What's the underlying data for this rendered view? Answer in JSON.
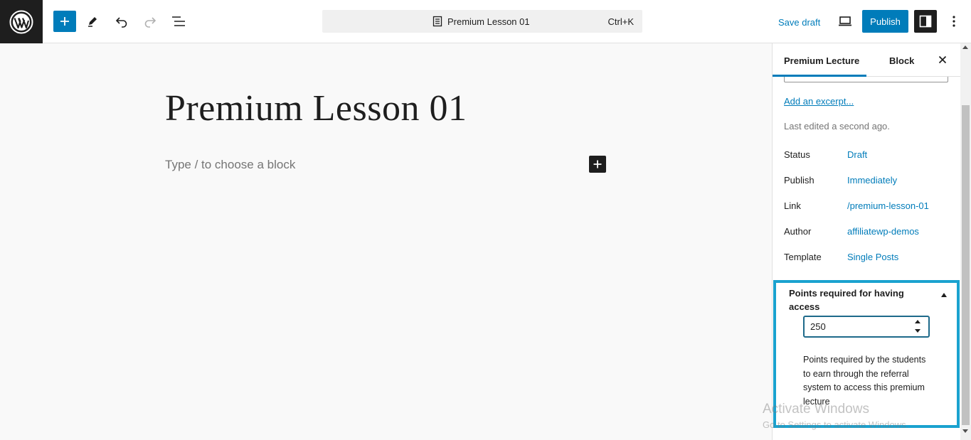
{
  "topbar": {
    "logo_icon": "wordpress-logo",
    "add_block_icon": "plus-icon",
    "tools_icon": "pencil-icon",
    "undo_icon": "undo-icon",
    "redo_icon": "redo-icon",
    "list_view_icon": "list-view-icon",
    "command_bar": {
      "title": "Premium Lesson 01",
      "shortcut": "Ctrl+K",
      "icon": "document-icon"
    },
    "save_draft_label": "Save draft",
    "preview_icon": "laptop-icon",
    "publish_label": "Publish",
    "settings_icon": "sidebar-toggle-icon",
    "more_icon": "vertical-ellipsis-icon"
  },
  "editor": {
    "post_title": "Premium Lesson 01",
    "block_placeholder": "Type / to choose a block"
  },
  "sidebar": {
    "tabs": [
      {
        "label": "Premium Lecture",
        "active": true
      },
      {
        "label": "Block",
        "active": false
      }
    ],
    "close_icon": "close-icon",
    "add_excerpt_label": "Add an excerpt...",
    "last_edited": "Last edited a second ago.",
    "meta": [
      {
        "label": "Status",
        "value": "Draft"
      },
      {
        "label": "Publish",
        "value": "Immediately"
      },
      {
        "label": "Link",
        "value": "/premium-lesson-01"
      },
      {
        "label": "Author",
        "value": "affiliatewp-demos"
      },
      {
        "label": "Template",
        "value": "Single Posts"
      }
    ],
    "points_panel": {
      "title": "Points required for having access",
      "value": "250",
      "help": "Points required by the students to earn through the referral system to access this premium lecture"
    }
  },
  "watermark": {
    "line1": "Activate Windows",
    "line2": "Go to Settings to activate Windows."
  },
  "colors": {
    "accent": "#007cba",
    "highlight_border": "#1aa2cf",
    "dark": "#1e1e1e"
  }
}
